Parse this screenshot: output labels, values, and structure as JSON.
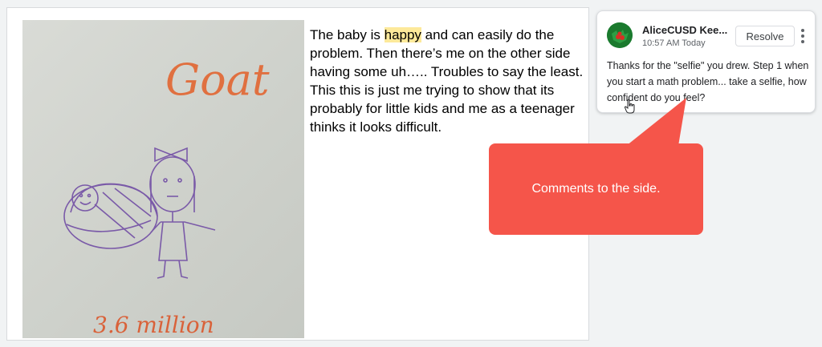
{
  "document": {
    "paragraph_before": "The baby is ",
    "highlighted_word": "happy",
    "paragraph_after": " and can easily do the problem. Then there’s me on the other side having some uh….. Troubles to say the least. This this is just me trying to show that its probably for little kids and me as a teenager thinks it looks difficult.",
    "drawing": {
      "title_text": "Goat",
      "caption_text": "3.6 million"
    }
  },
  "comment": {
    "author": "AliceCUSD Kee...",
    "time": "10:57 AM Today",
    "resolve_label": "Resolve",
    "body": "Thanks for the \"selfie\" you drew. Step 1 when you start a math problem... take a selfie, how confident do you feel?"
  },
  "callout": {
    "text": "Comments to the side.",
    "color": "#f5554a"
  },
  "colors": {
    "highlight": "#fde99a",
    "ink_orange": "#e07040",
    "ink_purple": "#7a5aa8"
  }
}
